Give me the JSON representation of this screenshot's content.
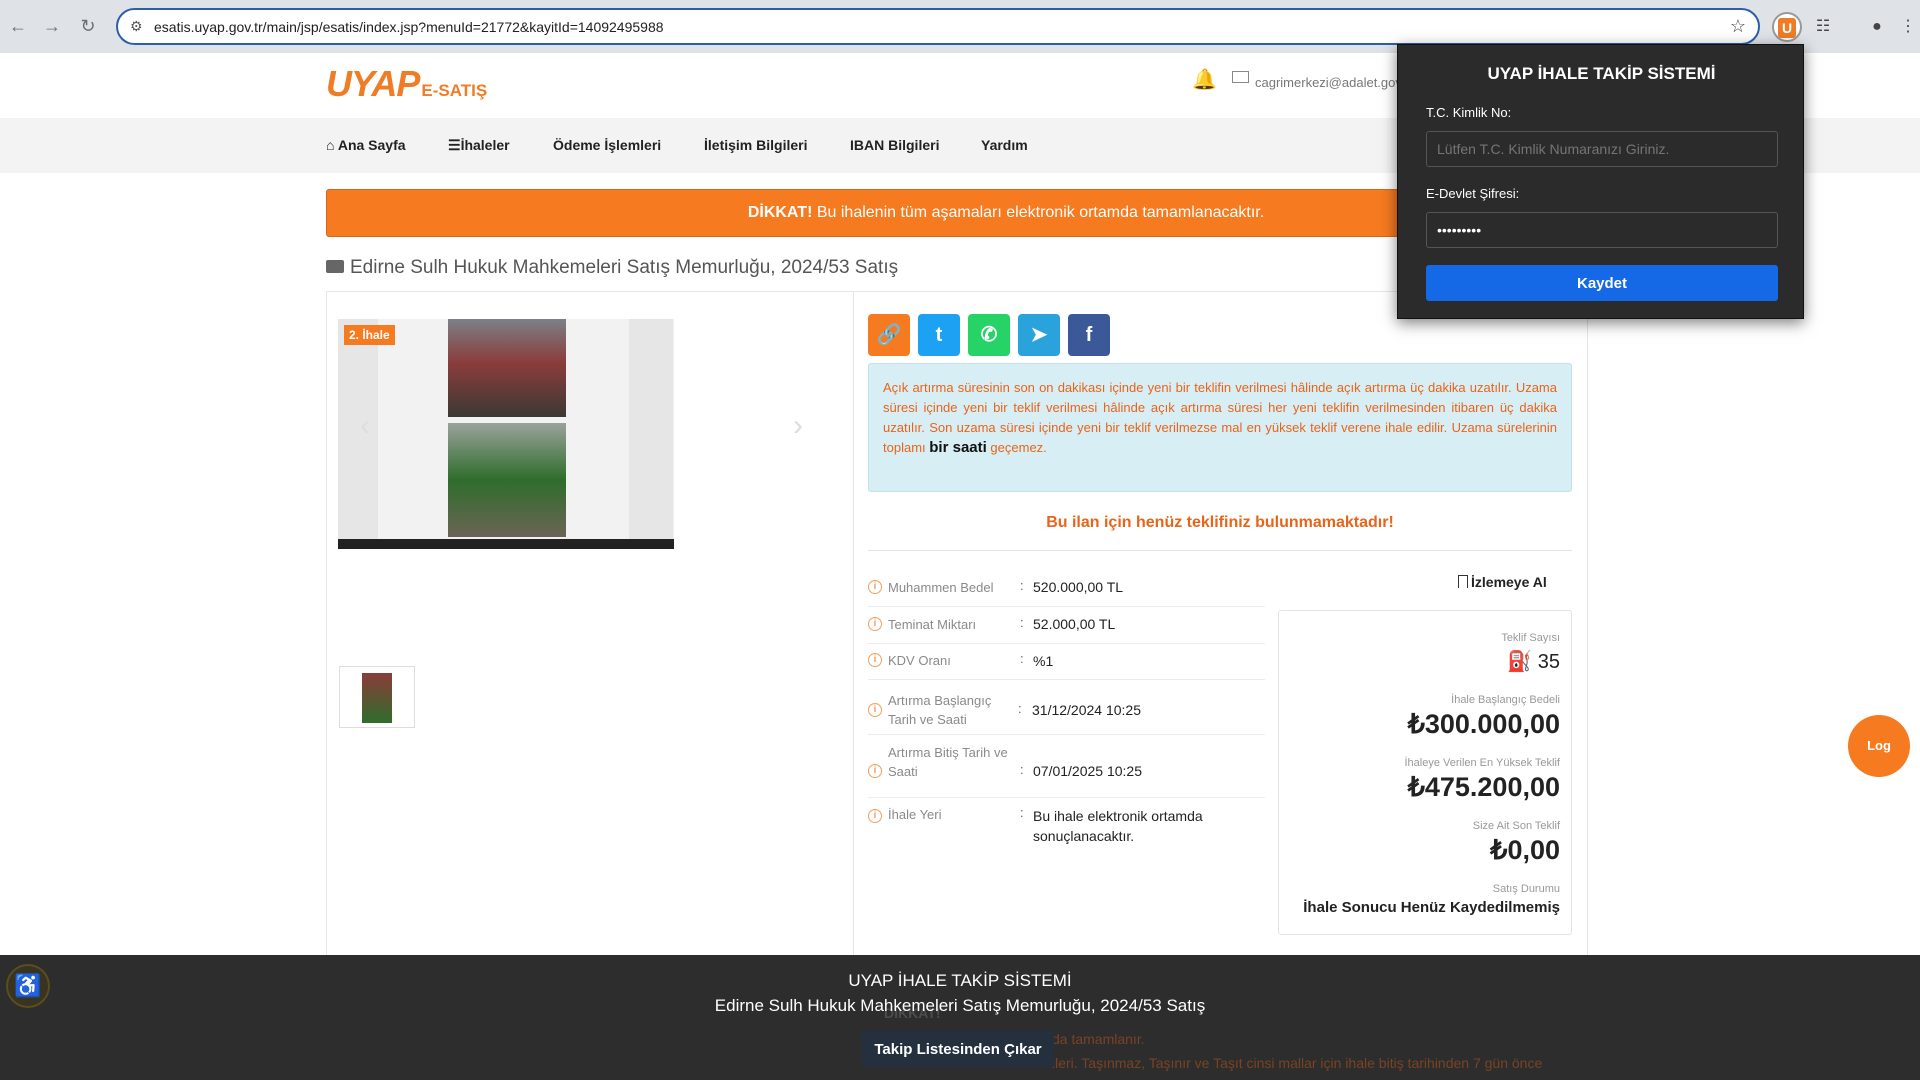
{
  "browser": {
    "url": "esatis.uyap.gov.tr/main/jsp/esatis/index.jsp?menuId=21772&kayitId=14092495988"
  },
  "header": {
    "logo_main": "UYAP",
    "logo_sub": "E-SATIŞ",
    "email": "cagrimerkezi@adalet.gov"
  },
  "nav": {
    "items": [
      "Ana Sayfa",
      "İhaleler",
      "Ödeme İşlemleri",
      "İletişim Bilgileri",
      "IBAN Bilgileri",
      "Yardım"
    ]
  },
  "alert": {
    "prefix": "DİKKAT!",
    "text": "Bu ihalenin tüm aşamaları elektronik ortamda tamamlanacaktır."
  },
  "auction": {
    "title": "Edirne Sulh Hukuk Mahkemeleri Satış Memurluğu, 2024/53 Satış",
    "ribbon": "2. İhale"
  },
  "info": {
    "text": "Açık artırma süresinin son on dakikası içinde yeni bir teklifin verilmesi hâlinde açık artırma üç dakika uzatılır. Uzama süresi içinde yeni bir teklif verilmesi hâlinde açık artırma süresi her yeni teklifin verilmesinden itibaren üç dakika uzatılır. Son uzama süresi içinde yeni bir teklif verilmezse mal en yüksek teklif verene ihale edilir. Uzama sürelerinin toplamı",
    "bold": "bir saati",
    "suffix": "geçemez."
  },
  "no_bid": "Bu ilan için henüz teklifiniz bulunmamaktadır!",
  "details": [
    {
      "label": "Muhammen Bedel",
      "value": "520.000,00 TL"
    },
    {
      "label": "Teminat Miktarı",
      "value": "52.000,00 TL"
    },
    {
      "label": "KDV Oranı",
      "value": "%1"
    },
    {
      "label": "Artırma Başlangıç Tarih ve Saati",
      "value": "31/12/2024 10:25"
    },
    {
      "label": "Artırma Bitiş Tarih ve Saati",
      "value": "07/01/2025 10:25"
    },
    {
      "label": "İhale Yeri",
      "value": "Bu ihale elektronik ortamda sonuçlanacaktır."
    }
  ],
  "watch_label": "İzlemeye Al",
  "bids": {
    "count_label": "Teklif Sayısı",
    "count": "35",
    "start_label": "İhale Başlangıç Bedeli",
    "start_value": "₺300.000,00",
    "highest_label": "İhaleye Verilen En Yüksek Teklif",
    "highest_value": "₺475.200,00",
    "mine_label": "Size Ait Son Teklif",
    "mine_value": "₺0,00",
    "status_label": "Satış Durumu",
    "status_value": "İhale Sonucu Henüz Kaydedilmemiş"
  },
  "popup": {
    "title": "UYAP İHALE TAKİP SİSTEMİ",
    "tc_label": "T.C. Kimlik No:",
    "tc_placeholder": "Lütfen T.C. Kimlik Numaranızı Giriniz.",
    "pw_label": "E-Devlet Şifresi:",
    "pw_value": "•••••••••",
    "save": "Kaydet"
  },
  "bottom": {
    "title": "UYAP İHALE TAKİP SİSTEMİ",
    "subtitle": "Edirne Sulh Hukuk Mahkemeleri Satış Memurluğu, 2024/53 Satış",
    "button": "Takip Listesinden Çıkar"
  },
  "ghost_text": {
    "dikkat": "DİKKAT!",
    "line1": "da tamamlanır.",
    "line2": "ileri. Taşınmaz, Taşınır ve Taşıt cinsi mallar için ihale bitiş tarihinden 7 gün önce"
  },
  "log_button": "Log"
}
